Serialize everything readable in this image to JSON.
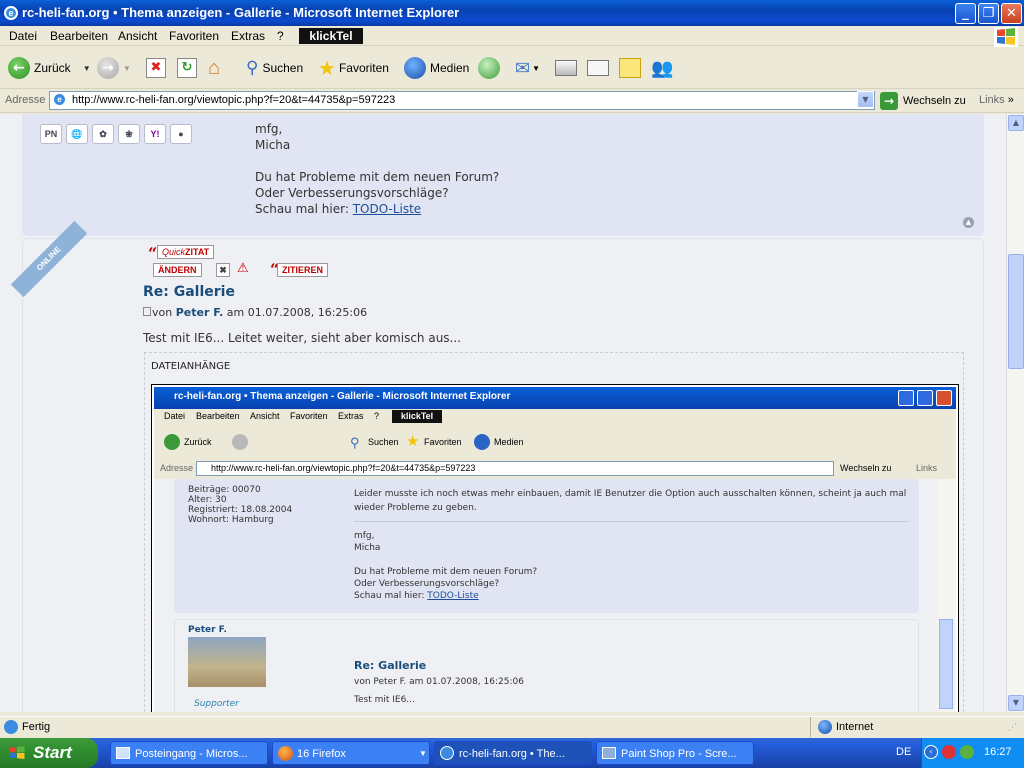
{
  "window": {
    "title": "rc-heli-fan.org • Thema anzeigen - Gallerie - Microsoft Internet Explorer"
  },
  "menu": [
    "Datei",
    "Bearbeiten",
    "Ansicht",
    "Favoriten",
    "Extras",
    "?"
  ],
  "klicktel": "klickTel",
  "toolbar": {
    "back": "Zurück",
    "search": "Suchen",
    "favorites": "Favoriten",
    "media": "Medien"
  },
  "address": {
    "label": "Adresse",
    "url": "http://www.rc-heli-fan.org/viewtopic.php?f=20&t=44735&p=597223",
    "go": "Wechseln zu",
    "links": "Links"
  },
  "post1": {
    "sig_lines": [
      "mfg,",
      "Micha",
      "",
      "Du hat Probleme mit dem neuen Forum?",
      "Oder Verbesserungsvorschläge?"
    ],
    "sig_last_prefix": "Schau mal hier: ",
    "sig_link": "TODO-Liste",
    "profile_icons": [
      "PN",
      "www",
      "icq",
      "msn",
      "yahoo",
      "jabber"
    ]
  },
  "post2": {
    "online_badge": "ONLINE",
    "quickzitat_label": "ZITAT",
    "quick_prefix": "Quick",
    "edit": "ÄNDERN",
    "quote": "ZITIEREN",
    "title": "Re: Gallerie",
    "by_prefix": "von ",
    "author": "Peter F.",
    "date": " am 01.07.2008, 16:25:06",
    "body": "Test mit IE6... Leitet weiter, sieht aber komisch aus...",
    "attachments_label": "DATEIANHÄNGE"
  },
  "inner": {
    "title": "rc-heli-fan.org • Thema anzeigen - Gallerie - Microsoft Internet Explorer",
    "menu": [
      "Datei",
      "Bearbeiten",
      "Ansicht",
      "Favoriten",
      "Extras",
      "?"
    ],
    "back": "Zurück",
    "search": "Suchen",
    "favorites": "Favoriten",
    "media": "Medien",
    "address_label": "Adresse",
    "url": "http://www.rc-heli-fan.org/viewtopic.php?f=20&t=44735&p=597223",
    "go": "Wechseln zu",
    "links": "Links",
    "profile": [
      "Beiträge: 00070",
      "Alter: 30",
      "Registriert: 18.08.2004",
      "Wohnort: Hamburg"
    ],
    "body_line1": "Leider musste ich noch etwas mehr einbauen, damit IE Benutzer die Option auch ausschalten können, scheint ja auch mal",
    "body_line2": "wieder Probleme zu geben.",
    "sig": [
      "mfg,",
      "Micha",
      "",
      "Du hat Probleme mit dem neuen Forum?",
      "Oder Verbesserungsvorschläge?"
    ],
    "sig_prefix": "Schau mal hier: ",
    "sig_link": "TODO-Liste",
    "author2": "Peter F.",
    "title2": "Re: Gallerie",
    "date2": "von Peter F. am 01.07.2008, 16:25:06",
    "body2": "Test mit IE6...",
    "supporter": "Supporter"
  },
  "status": {
    "left": "Fertig",
    "zone": "Internet"
  },
  "taskbar": {
    "start": "Start",
    "tasks": [
      "Posteingang - Micros...",
      "16 Firefox",
      "rc-heli-fan.org • The...",
      "Paint Shop Pro - Scre..."
    ],
    "lang": "DE",
    "time": "16:27"
  }
}
